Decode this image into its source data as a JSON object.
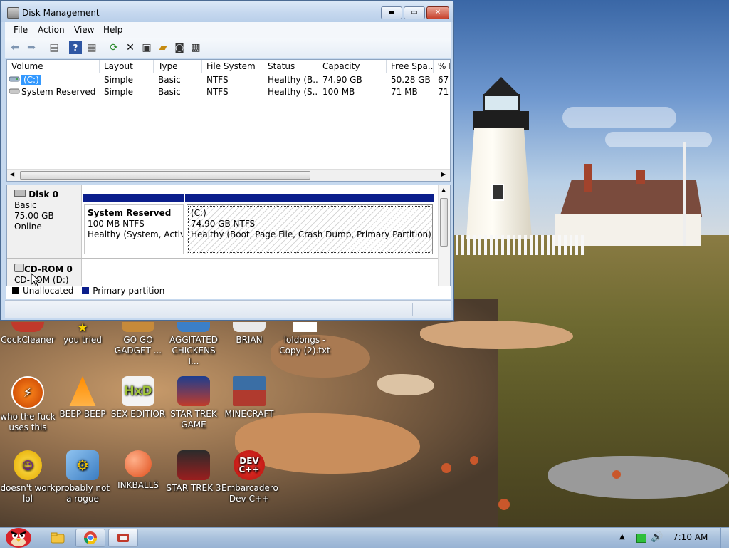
{
  "window": {
    "title": "Disk Management",
    "controls": {
      "minimize": "▬",
      "maximize": "▭",
      "close": "✕"
    }
  },
  "menu": [
    "File",
    "Action",
    "View",
    "Help"
  ],
  "toolbar_icons": [
    "back-arrow-icon",
    "forward-arrow-icon",
    "console-tree-icon",
    "help-icon",
    "properties-pane-icon",
    "refresh-icon",
    "delete-icon",
    "properties-icon",
    "open-folder-icon",
    "rescan-icon",
    "settings-icon"
  ],
  "volumes": {
    "columns": [
      "Volume",
      "Layout",
      "Type",
      "File System",
      "Status",
      "Capacity",
      "Free Spa...",
      "% F"
    ],
    "rows": [
      [
        "(C:)",
        "Simple",
        "Basic",
        "NTFS",
        "Healthy (B...",
        "74.90 GB",
        "50.28 GB",
        "67"
      ],
      [
        "System Reserved",
        "Simple",
        "Basic",
        "NTFS",
        "Healthy (S...",
        "100 MB",
        "71 MB",
        "71"
      ]
    ]
  },
  "disks": [
    {
      "name": "Disk 0",
      "type": "Basic",
      "size": "75.00 GB",
      "state": "Online",
      "partitions": [
        {
          "name": "System Reserved",
          "size_fs": "100 MB NTFS",
          "status": "Healthy (System, Active,"
        },
        {
          "name": "(C:)",
          "size_fs": "74.90 GB NTFS",
          "status": "Healthy (Boot, Page File, Crash Dump, Primary Partition)"
        }
      ]
    },
    {
      "name": "CD-ROM 0",
      "sub": "CD-ROM (D:)"
    }
  ],
  "legend": [
    {
      "label": "Unallocated",
      "color": "#000000"
    },
    {
      "label": "Primary partition",
      "color": "#0b1e8c"
    }
  ],
  "desktop_icons": [
    {
      "label": "CockCleaner",
      "icon": "ccleaner-icon"
    },
    {
      "label": "you tried",
      "icon": "star-icon"
    },
    {
      "label": "GO GO GADGET ...",
      "icon": "gadget-icon"
    },
    {
      "label": "AGGITATED CHICKENS I...",
      "icon": "chicken-icon"
    },
    {
      "label": "BRIAN",
      "icon": "brian-icon"
    },
    {
      "label": "loldongs - Copy (2).txt",
      "icon": "text-file-icon"
    },
    {
      "label": "who the fuck uses this",
      "icon": "winamp-icon"
    },
    {
      "label": "BEEP BEEP",
      "icon": "vlc-icon"
    },
    {
      "label": "SEX EDITIOR",
      "icon": "hxd-icon"
    },
    {
      "label": "STAR TREK GAME",
      "icon": "star-trek-icon"
    },
    {
      "label": "MINECRAFT",
      "icon": "minecraft-icon"
    },
    {
      "label": "doesn't work lol",
      "icon": "yahoo-messenger-icon"
    },
    {
      "label": "probably not a rogue",
      "icon": "gear-program-icon"
    },
    {
      "label": "INKBALLS",
      "icon": "inkball-icon"
    },
    {
      "label": "STAR TREK 3",
      "icon": "star-trek-3-icon"
    },
    {
      "label": "Embarcadero Dev-C++",
      "icon": "devcpp-icon"
    }
  ],
  "devcpp_badge": "DEV C++",
  "hxd_badge": "HxD",
  "taskbar": {
    "clock": "7:10 AM",
    "pinned": [
      "start-icon",
      "file-explorer-icon",
      "chrome-icon",
      "disk-management-taskbar-icon"
    ]
  }
}
